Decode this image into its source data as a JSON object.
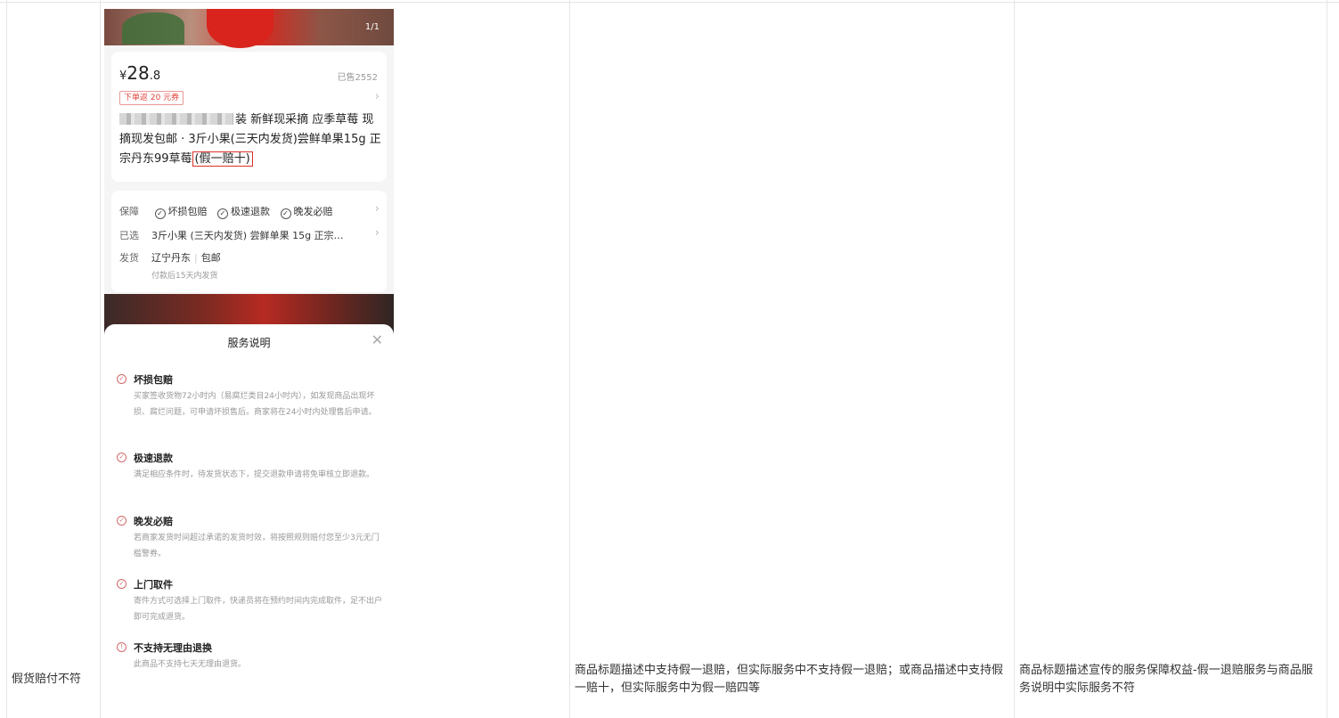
{
  "table": {
    "col1": "假货赔付不符",
    "col3": "商品标题描述中支持假一退赔，但实际服务中不支持假一退赔；或商品描述中支持假一赔十，但实际服务中为假一赔四等",
    "col4": "商品标题描述宣传的服务保障权益-假一退赔服务与商品服务说明中实际服务不符"
  },
  "product": {
    "image_counter": "1/1",
    "price_symbol": "¥",
    "price_int": "28",
    "price_dec": ".8",
    "sold": "已售2552",
    "coupon": "下单返 20 元券",
    "title_text": "装 新鲜现采摘 应季草莓 现摘现发包邮 · 3斤小果(三天内发货)尝鲜单果15g 正宗丹东99草莓",
    "title_highlight": "(假一赔十)"
  },
  "guarantee": {
    "label": "保障",
    "items": [
      "坏损包赔",
      "极速退款",
      "晚发必赔"
    ]
  },
  "selected": {
    "label": "已选",
    "value": "3斤小果 (三天内发货) 尝鲜单果 15g 正宗…"
  },
  "shipping": {
    "label": "发货",
    "origin": "辽宁丹东",
    "fee": "包邮",
    "note": "付款后15天内发货"
  },
  "sheet": {
    "title": "服务说明",
    "close": "✕",
    "items": [
      {
        "title": "坏损包赔",
        "desc": "买家签收货物72小时内（易腐烂类目24小时内），如发现商品出现坏损、腐烂问题，可申请坏损售后。商家将在24小时内处理售后申请。"
      },
      {
        "title": "极速退款",
        "desc": "满足相应条件时，待发货状态下，提交退款申请将免审核立即退款。"
      },
      {
        "title": "晚发必赔",
        "desc": "若商家发货时间超过承诺的发货时效，将按照规则赔付您至少3元无门槛警券。"
      },
      {
        "title": "上门取件",
        "desc": "寄件方式可选择上门取件，快递员将在预约时间内完成取件，足不出户即可完成退货。"
      },
      {
        "title": "不支持无理由退换",
        "desc": "此商品不支持七天无理由退货。"
      }
    ]
  },
  "colors": {
    "accent_red": "#d9332b",
    "grid_line": "#e4e6ea"
  }
}
